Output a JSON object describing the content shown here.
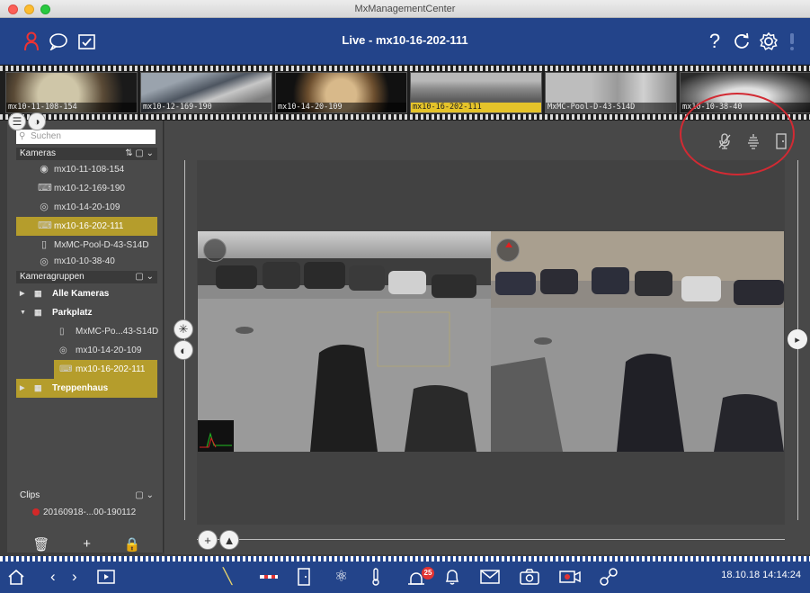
{
  "window": {
    "title": "MxManagementCenter"
  },
  "header": {
    "view_title": "Live - mx10-16-202-111",
    "help": "?"
  },
  "filmstrip": {
    "thumbs": [
      {
        "label": "mx10-11-108-154"
      },
      {
        "label": "mx10-12-169-190"
      },
      {
        "label": "mx10-14-20-109"
      },
      {
        "label": "mx10-16-202-111"
      },
      {
        "label": "MxMC-Pool-D-43-S14D"
      },
      {
        "label": "mx10-10-38-40"
      }
    ]
  },
  "sidebar": {
    "search_placeholder": "Suchen",
    "cameras_header": "Kameras",
    "cameras": [
      {
        "label": "mx10-11-108-154"
      },
      {
        "label": "mx10-12-169-190"
      },
      {
        "label": "mx10-14-20-109"
      },
      {
        "label": "mx10-16-202-111"
      },
      {
        "label": "MxMC-Pool-D-43-S14D"
      },
      {
        "label": "mx10-10-38-40"
      }
    ],
    "groups_header": "Kameragruppen",
    "groups": [
      {
        "label": "Alle Kameras"
      },
      {
        "label": "Parkplatz"
      },
      {
        "label": "Treppenhaus"
      }
    ],
    "parkplatz_items": [
      {
        "label": "MxMC-Po...43-S14D"
      },
      {
        "label": "mx10-14-20-109"
      },
      {
        "label": "mx10-16-202-111"
      }
    ],
    "clips_header": "Clips",
    "clip_item": "20160918-...00-190112"
  },
  "statusbar": {
    "datetime": "18.10.18 14:14:24",
    "alarm_count": "25"
  },
  "colors": {
    "header_blue": "#23448a",
    "selection_gold": "#b59d2c",
    "annotation_red": "#d22a33"
  }
}
